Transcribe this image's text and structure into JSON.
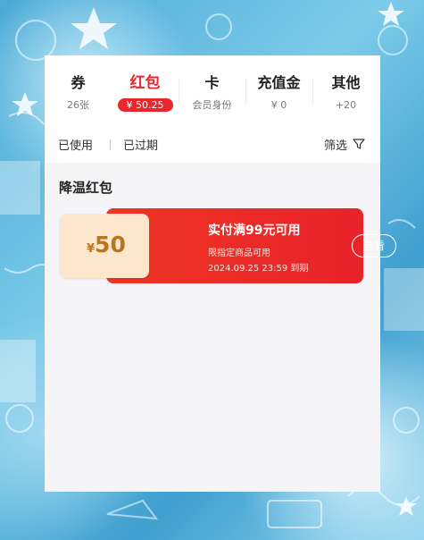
{
  "tabs": [
    {
      "label": "券",
      "sub": "26张"
    },
    {
      "label": "红包",
      "sub": "¥ 50.25"
    },
    {
      "label": "卡",
      "sub": "会员身份"
    },
    {
      "label": "充值金",
      "sub": "¥ 0"
    },
    {
      "label": "其他",
      "sub": "+20"
    }
  ],
  "filters": {
    "used": "已使用",
    "expired": "已过期",
    "filter_label": "筛选"
  },
  "section_title": "降温红包",
  "coupon": {
    "currency": "¥",
    "amount": "50",
    "title": "实付满99元可用",
    "desc": "限指定商品可用",
    "expiry": "2024.09.25 23:59 到期",
    "view_label": "查看"
  },
  "colors": {
    "accent": "#e8262b",
    "coupon_left_bg": "#fce6cc",
    "amount_color": "#b87420"
  }
}
